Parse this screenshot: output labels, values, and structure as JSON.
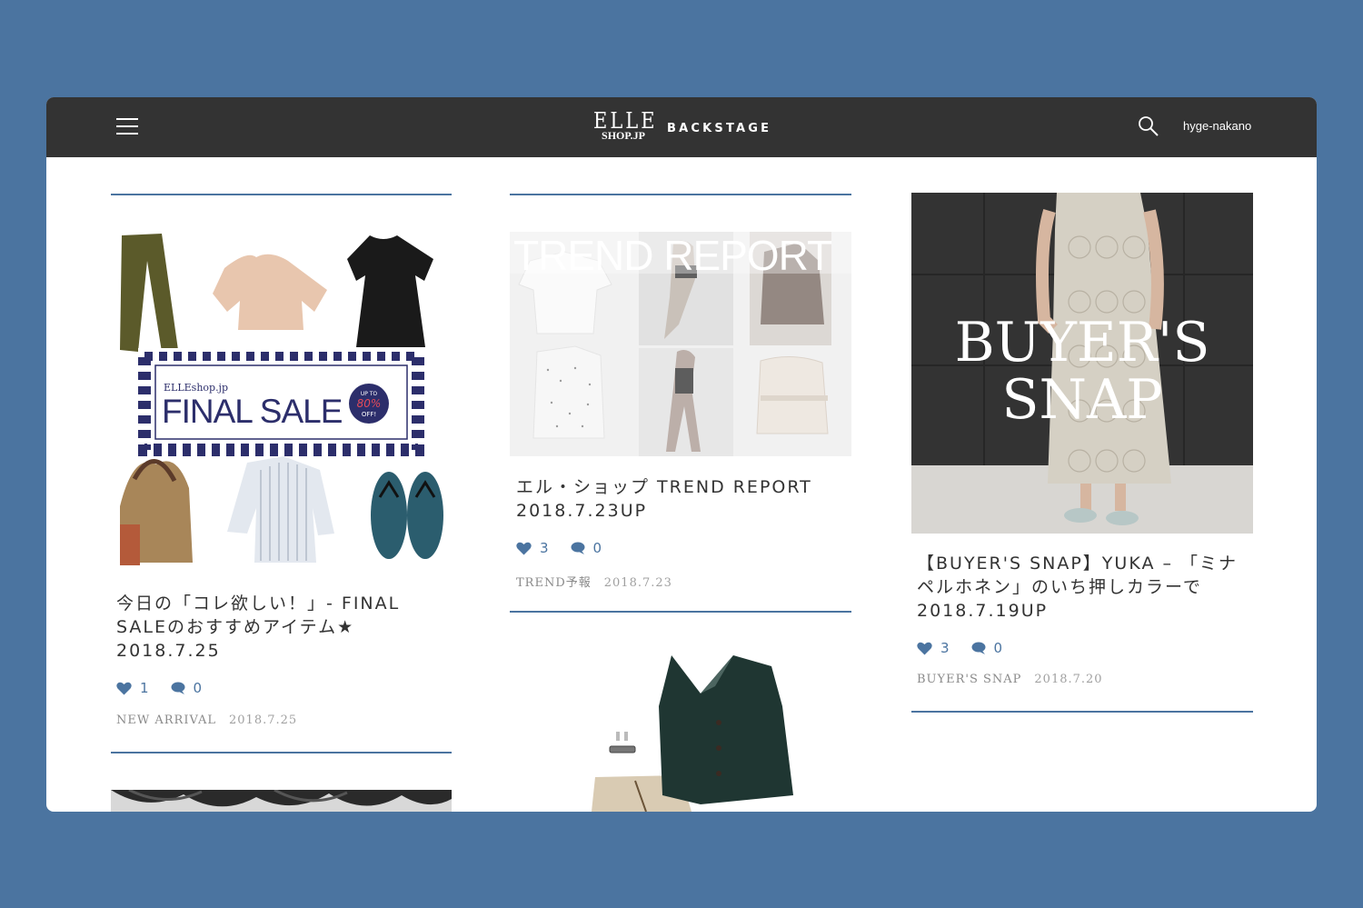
{
  "header": {
    "logo_elle": "ELLE",
    "logo_shop": "SHOP.JP",
    "site_name": "BACKSTAGE",
    "username": "hyge-nakano"
  },
  "cards": [
    {
      "title": "今日の「コレ欲しい！」- FINAL SALEのおすすめアイテム★　2018.7.25",
      "likes": "1",
      "comments": "0",
      "category": "NEW ARRIVAL",
      "date": "2018.7.25",
      "image": {
        "banner_brand": "ELLEshop.jp",
        "banner_text": "FINAL SALE",
        "badge_top": "UP TO",
        "badge_pct": "80%",
        "badge_bottom": "OFF!"
      }
    },
    {
      "title": "エル・ショップ TREND REPORT 2018.7.23UP",
      "likes": "3",
      "comments": "0",
      "category": "TREND予報",
      "date": "2018.7.23",
      "image": {
        "overlay_text": "TREND REPORT"
      }
    },
    {
      "title": "【BUYER'S SNAP】YUKA – 「ミナ ペルホネン」のいち押しカラーで　2018.7.19UP",
      "likes": "3",
      "comments": "0",
      "category": "BUYER'S SNAP",
      "date": "2018.7.20",
      "image": {
        "overlay_line1": "BUYER'S",
        "overlay_line2": "SNAP"
      }
    }
  ],
  "colors": {
    "accent": "#4b74a0",
    "topbar": "#333333"
  }
}
